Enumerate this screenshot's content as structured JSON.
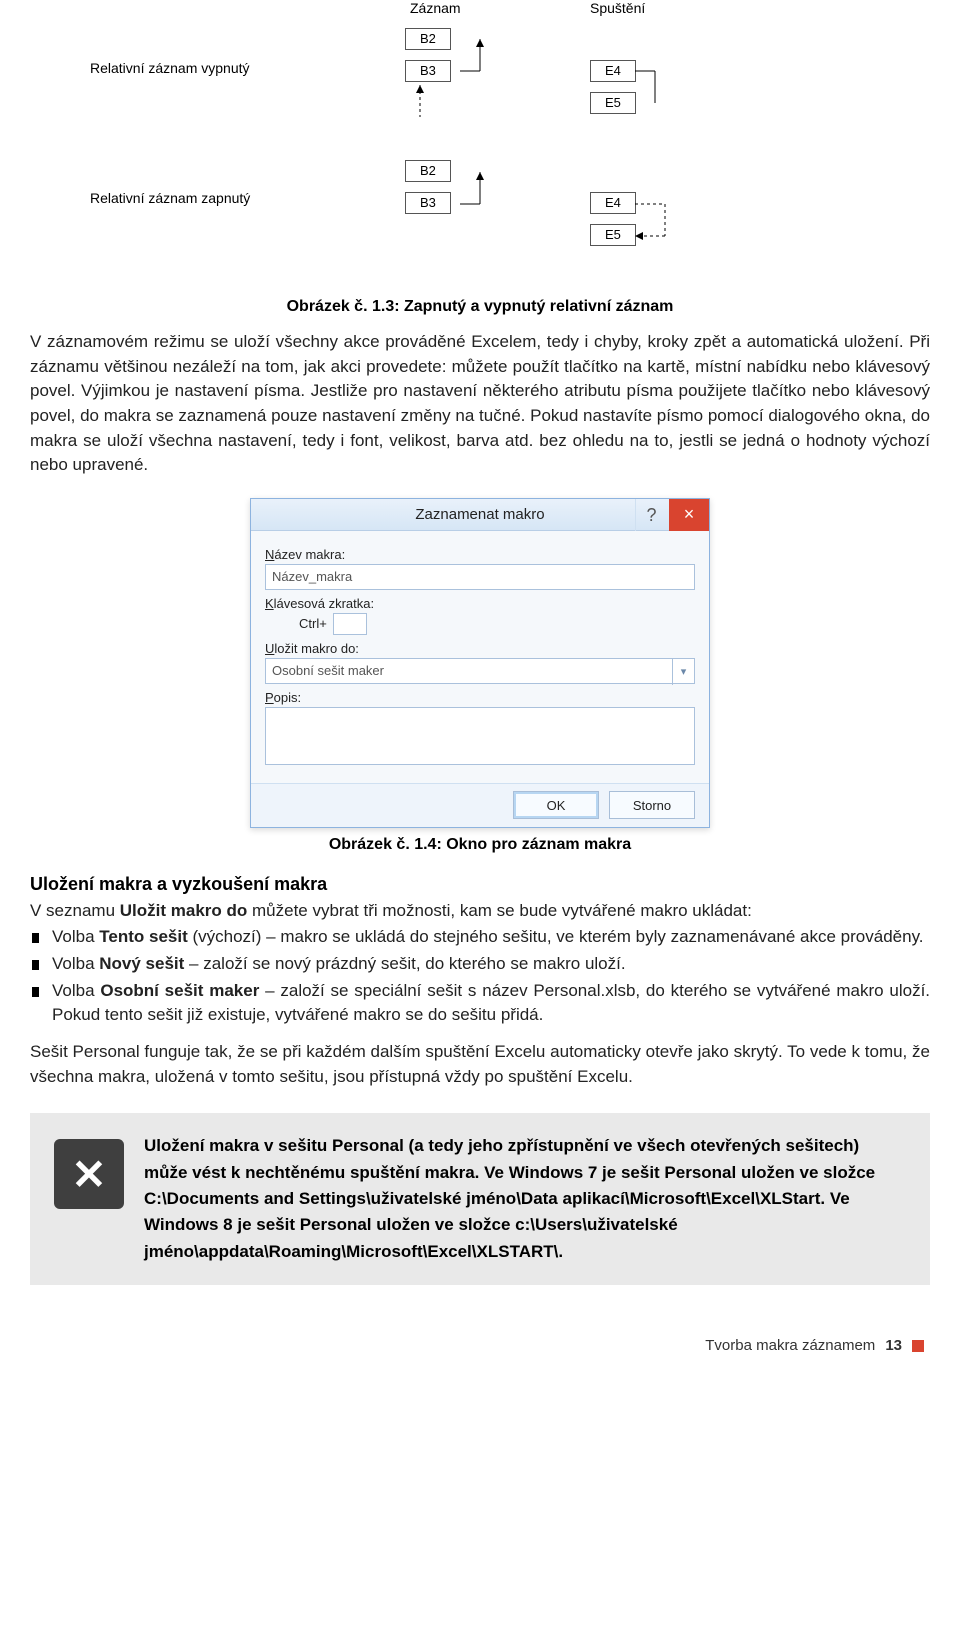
{
  "diagram": {
    "col1_header": "Záznam",
    "col2_header": "Spuštění",
    "row1_label": "Relativní záznam vypnutý",
    "row2_label": "Relativní záznam zapnutý",
    "cells": {
      "b2": "B2",
      "b3": "B3",
      "e4": "E4",
      "e5": "E5",
      "b2b": "B2",
      "b3b": "B3",
      "e4b": "E4",
      "e5b": "E5"
    }
  },
  "caption1": "Obrázek č. 1.3: Zapnutý a vypnutý relativní záznam",
  "para1": "V záznamovém režimu se uloží všechny akce prováděné Excelem, tedy i chyby, kroky zpět a auto­matická uložení. Při záznamu většinou nezáleží na tom, jak akci provedete: můžete použít tlačítko na kartě, místní nabídku nebo klávesový povel. Výjimkou je nastavení písma. Jestliže pro nastavení někte­rého atributu písma použijete tlačítko nebo klávesový povel, do makra se zaznamená pouze nastavení změny na tučné. Pokud nastavíte písmo pomocí dialogového okna, do makra se uloží všechna nasta­vení, tedy i font, velikost, barva atd. bez ohledu na to, jestli se jedná o hodnoty výchozí nebo upravené.",
  "dialog": {
    "title": "Zaznamenat makro",
    "help": "?",
    "close": "×",
    "name_label": "Název makra:",
    "name_value": "Název_makra",
    "shortcut_label": "Klávesová zkratka:",
    "ctrl_label": "Ctrl+",
    "store_label": "Uložit makro do:",
    "store_value": "Osobní sešit maker",
    "desc_label": "Popis:",
    "ok": "OK",
    "cancel": "Storno"
  },
  "caption2": "Obrázek č. 1.4: Okno pro záznam makra",
  "subheading": "Uložení makra a vyzkoušení makra",
  "para2_pre": "V seznamu ",
  "para2_bold": "Uložit makro do",
  "para2_post": " můžete vybrat tři možnosti, kam se bude vytvářené makro ukládat:",
  "bullets": [
    {
      "b": "Tento sešit",
      "pre": "Volba ",
      "post": " (výchozí) – makro se ukládá do stejného sešitu, ve kterém byly zaznamenávané akce prováděny."
    },
    {
      "b": "Nový sešit",
      "pre": "Volba ",
      "post": " – založí se nový prázdný sešit, do kterého se makro uloží."
    },
    {
      "b": "Osobní sešit maker",
      "pre": "Volba ",
      "post": " – založí se speciální sešit s název Personal.xlsb, do kterého se vytváře­né makro uloží. Pokud tento sešit již existuje, vytvářené makro se do sešitu přidá."
    }
  ],
  "para3": "Sešit Personal funguje tak, že se při každém dalším spuštění Excelu automaticky otevře jako skrytý. To vede k tomu, že všechna makra, uložená v tomto sešitu, jsou přístupná vždy po spuštění Excelu.",
  "note_icon": "✕",
  "note_text": "Uložení makra v sešitu Personal (a tedy jeho zpřístupnění ve všech otevřených sešitech) může vést k nechtěnému spuštění makra. Ve Windows 7 je sešit Personal uložen ve složce C:\\Documents and Settings\\uživatelské jméno\\Data aplikací\\Microsoft\\Excel\\XLStart. Ve Windows 8 je sešit Personal uložen ve složce c:\\Users\\uživatelské jméno\\appdata\\Roaming\\Microsoft\\Excel\\XLSTART\\.",
  "footer_text": "Tvorba makra záznamem",
  "footer_page": "13"
}
